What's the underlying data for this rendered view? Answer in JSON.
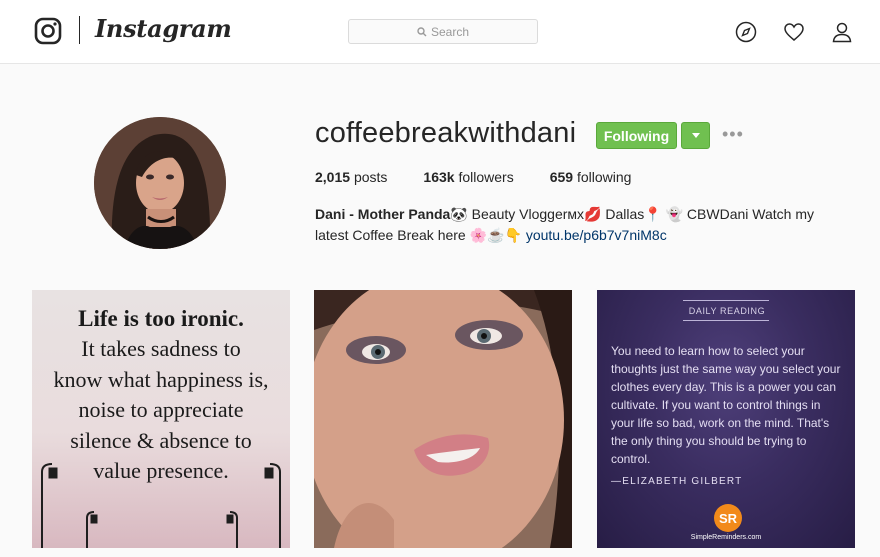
{
  "nav": {
    "wordmark": "Instagram",
    "search_placeholder": "Search",
    "icons": [
      "instagram-logo-icon",
      "compass-icon",
      "heart-icon",
      "person-icon"
    ]
  },
  "profile": {
    "username": "coffeebreakwithdani",
    "follow_label": "Following",
    "more_label": "•••",
    "stats": {
      "posts_count": "2,015",
      "posts_label": "posts",
      "followers_count": "163k",
      "followers_label": "followers",
      "following_count": "659",
      "following_label": "following"
    },
    "bio": {
      "name": "Dani - Mother Panda",
      "text1": " Beauty Vloggerᴍx",
      "text2": " Dallas",
      "text3": " CBWDani Watch my latest Coffee Break here ",
      "link": "youtu.be/p6b7v7niM8c"
    }
  },
  "posts": {
    "post1": {
      "title": "Life is too ironic.",
      "lines": [
        "It takes sadness to",
        "know what happiness is,",
        "noise to appreciate",
        "silence & absence to",
        "value presence."
      ]
    },
    "post3": {
      "label": "DAILY READING",
      "quote": "You need to learn how to select your thoughts just the same way you select your clothes every day. This is a power you can cultivate. If you want to control things in your life so bad, work on the mind. That's the only thing you should be trying to control.",
      "author": "—ELIZABETH GILBERT",
      "badge": "SR",
      "site": "SimpleReminders.com"
    }
  },
  "colors": {
    "follow_green": "#70c050",
    "link_blue": "#003569",
    "text": "#262626"
  }
}
